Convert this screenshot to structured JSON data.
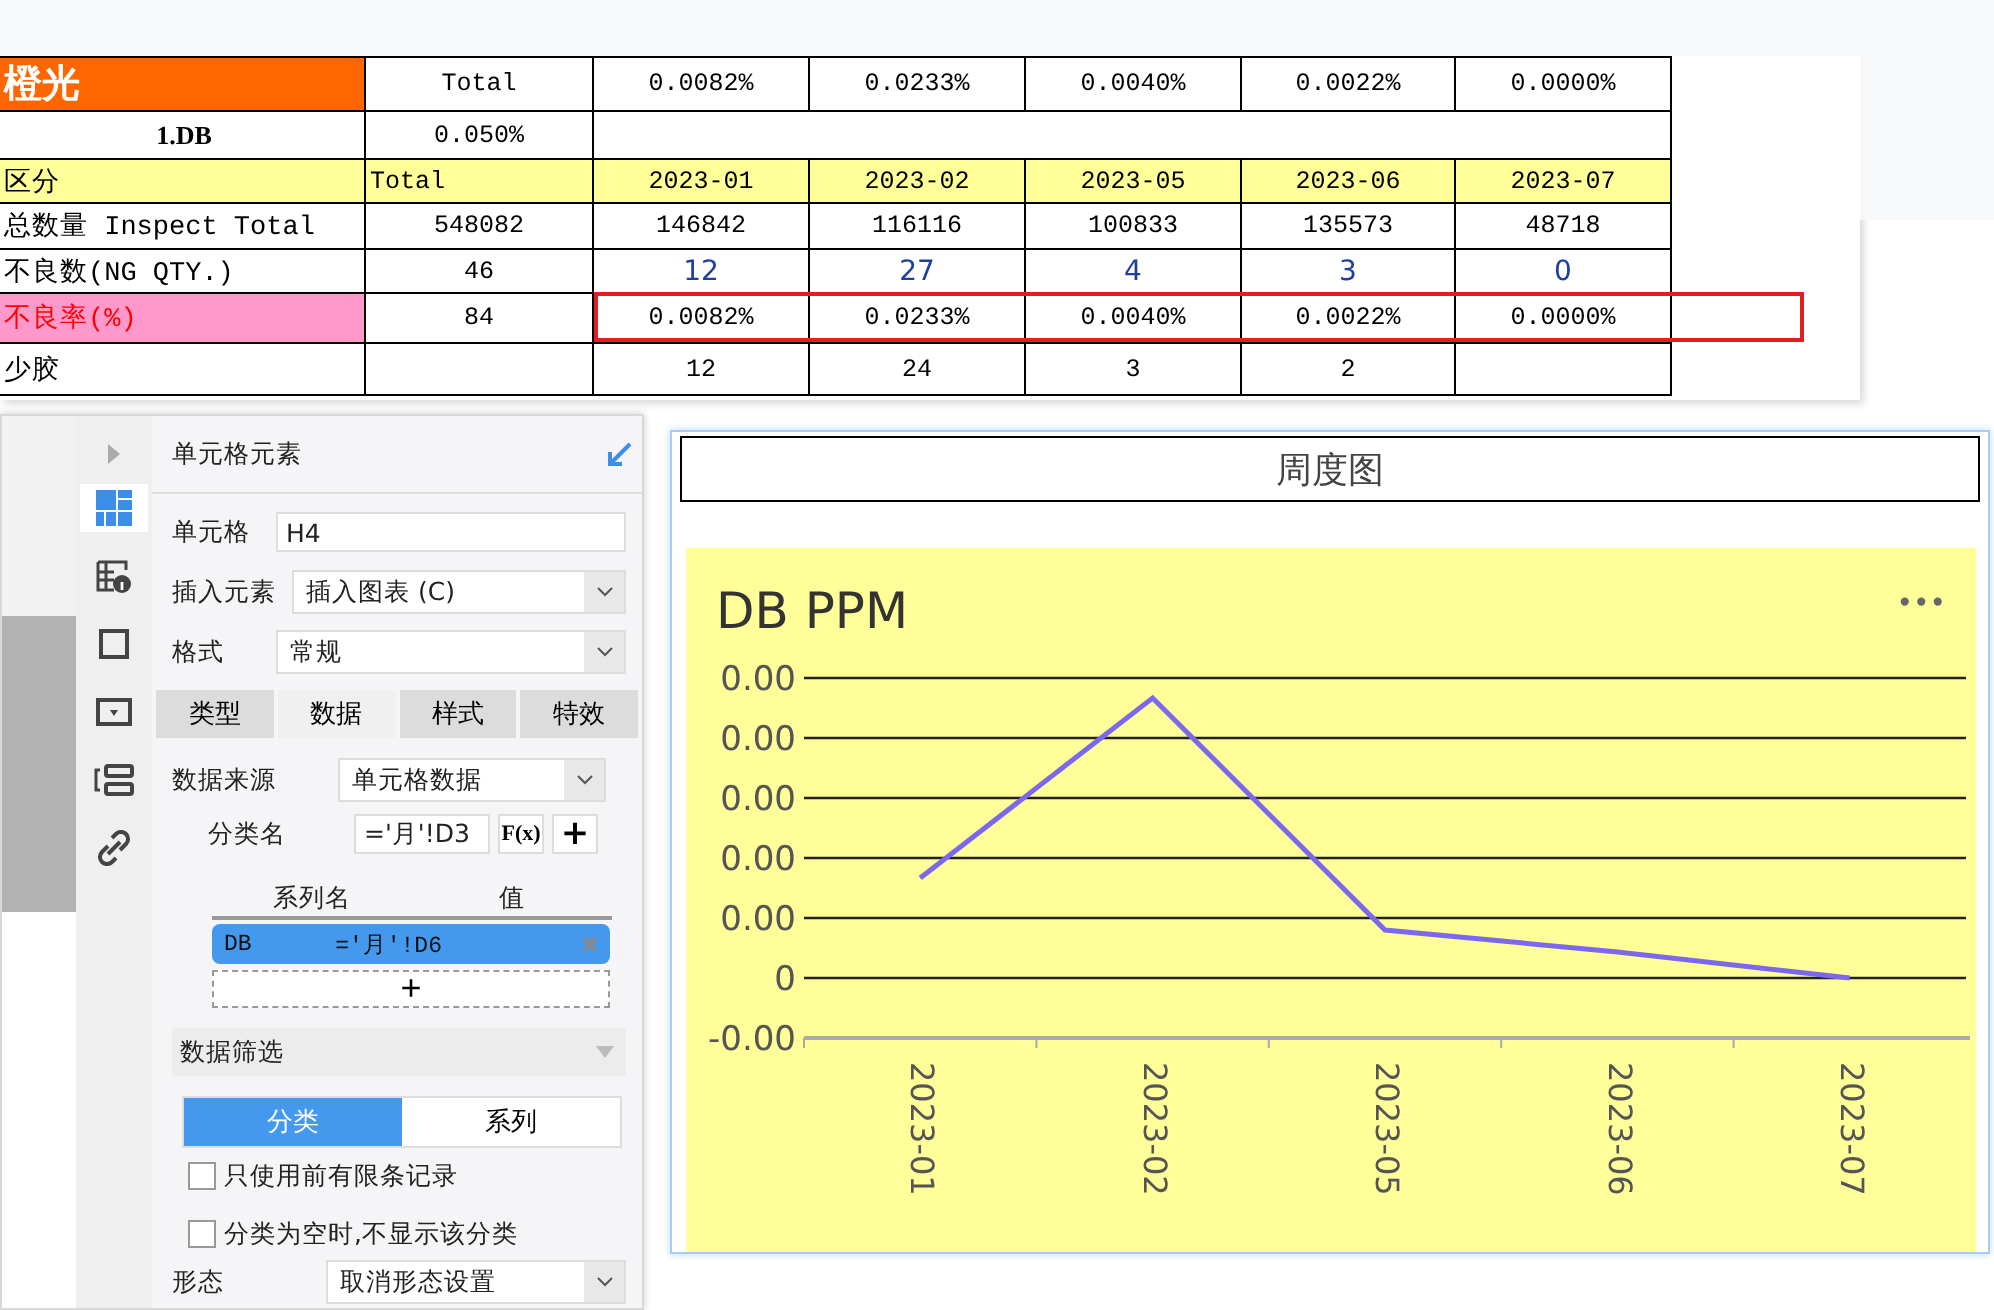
{
  "sheet": {
    "rows": [
      {
        "kind": "title",
        "cells": [
          "橙光",
          "Total",
          "0.0082%",
          "0.0233%",
          "0.0040%",
          "0.0022%",
          "0.0000%"
        ],
        "highlighted": false
      },
      {
        "kind": "subtitle",
        "cells": [
          "1.DB",
          "0.050%"
        ],
        "highlighted": false
      },
      {
        "kind": "header",
        "cells": [
          "区分",
          "Total",
          "2023-01",
          "2023-02",
          "2023-05",
          "2023-06",
          "2023-07"
        ],
        "highlighted": false
      },
      {
        "kind": "data",
        "cells": [
          "总数量 Inspect Total",
          "548082",
          "146842",
          "116116",
          "100833",
          "135573",
          "48718"
        ],
        "highlighted": false
      },
      {
        "kind": "count",
        "cells": [
          "不良数(NG QTY.)",
          "46",
          "12",
          "27",
          "4",
          "3",
          "0"
        ],
        "highlighted": false
      },
      {
        "kind": "rate",
        "cells": [
          "不良率(%)",
          "84",
          "0.0082%",
          "0.0233%",
          "0.0040%",
          "0.0022%",
          "0.0000%"
        ],
        "highlighted": true
      },
      {
        "kind": "data",
        "cells": [
          "少胶",
          null,
          "12",
          "24",
          "3",
          "2",
          null
        ],
        "highlighted": false
      }
    ]
  },
  "panel": {
    "title": "单元格元素",
    "side_icons": [
      {
        "kind": "grid",
        "selected": true
      },
      {
        "kind": "table-info",
        "selected": false
      },
      {
        "kind": "frame",
        "selected": false
      },
      {
        "kind": "dropdown",
        "selected": false
      },
      {
        "kind": "layout",
        "selected": false
      },
      {
        "kind": "link",
        "selected": false
      }
    ],
    "cell": {
      "label": "单元格",
      "value": "H4"
    },
    "insert": {
      "label": "插入元素",
      "value": "插入图表 (C)"
    },
    "format": {
      "label": "格式",
      "value": "常规"
    },
    "tabs": [
      {
        "label": "类型",
        "selected": false
      },
      {
        "label": "数据",
        "selected": true
      },
      {
        "label": "样式",
        "selected": false
      },
      {
        "label": "特效",
        "selected": false
      }
    ],
    "source": {
      "label": "数据来源",
      "value": "单元格数据"
    },
    "category": {
      "label": "分类名",
      "value": "='月'!D3",
      "fx": "F(x)",
      "add": "+"
    },
    "series_columns": [
      "系列名",
      "值"
    ],
    "series": [
      {
        "name": "DB",
        "value": "='月'!D6"
      }
    ],
    "series_add": "+",
    "filter": {
      "title": "数据筛选",
      "options": [
        {
          "label": "分类",
          "selected": true
        },
        {
          "label": "系列",
          "selected": false
        }
      ],
      "checks": [
        {
          "label": "只使用前有限条记录",
          "checked": false
        },
        {
          "label": "分类为空时,不显示该分类",
          "checked": false
        }
      ]
    },
    "shape": {
      "label": "形态",
      "value": "取消形态设置"
    }
  },
  "chart": {
    "caption": "周度图",
    "title": "DB PPM",
    "menu": "•••",
    "y_labels": [
      "0.00",
      "0.00",
      "0.00",
      "0.00",
      "0.00",
      "0",
      "-0.00"
    ],
    "categories": [
      "2023-01",
      "2023-02",
      "2023-05",
      "2023-06",
      "2023-07"
    ]
  }
}
